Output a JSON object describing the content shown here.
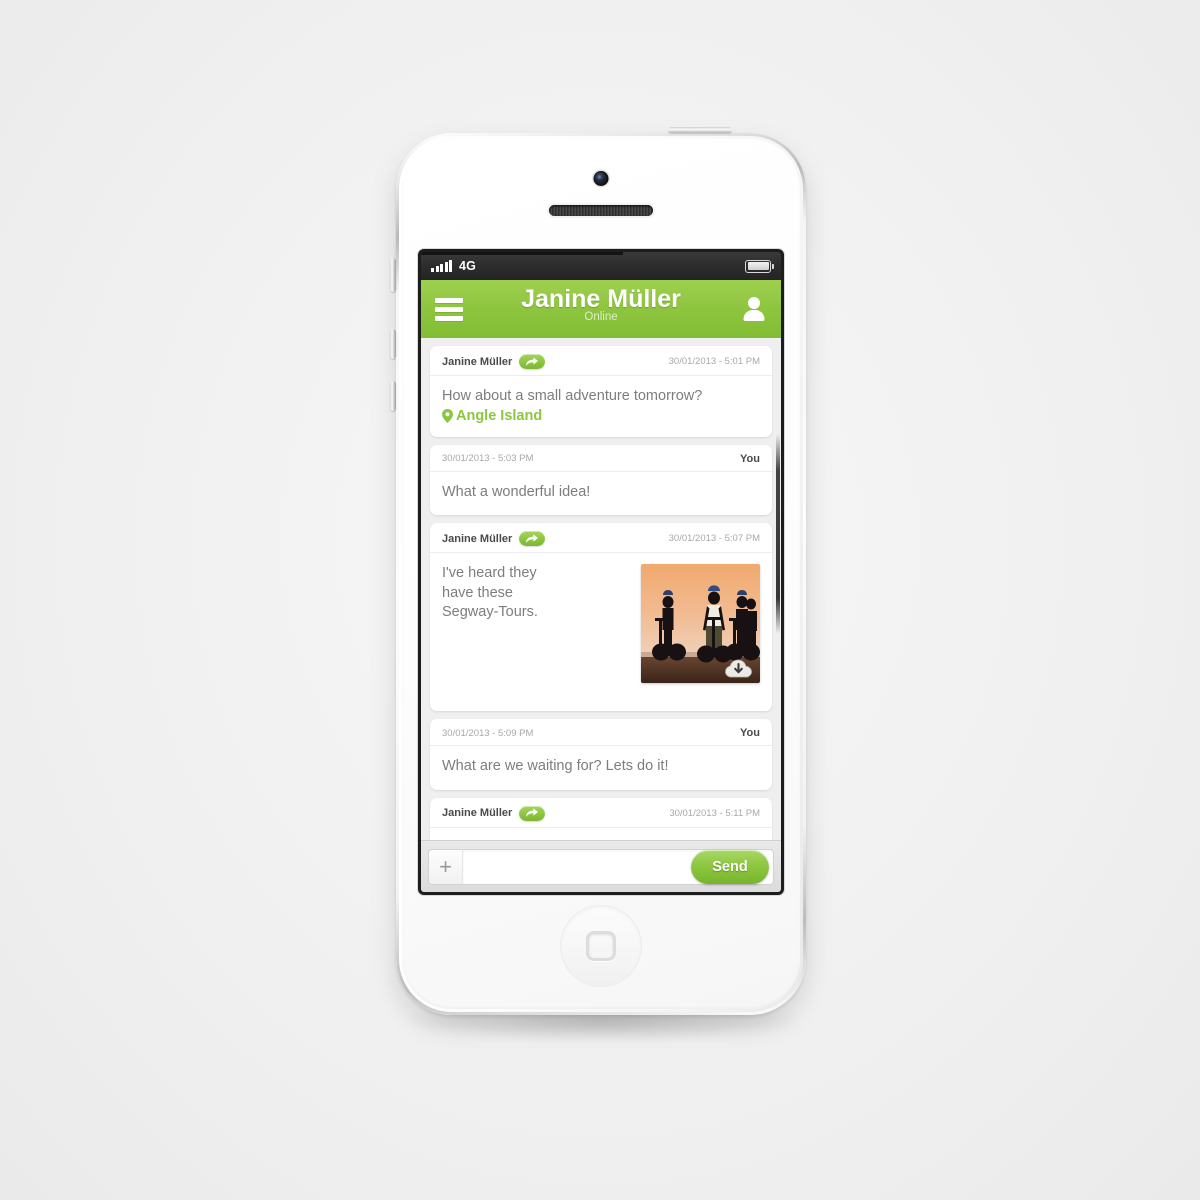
{
  "statusbar": {
    "signal_bars": 5,
    "network": "4G",
    "battery_icon": "battery-full-icon"
  },
  "header": {
    "menu_icon": "hamburger-menu-icon",
    "title": "Janine Müller",
    "status": "Online",
    "contact_icon": "contact-person-icon",
    "accent_color": "#8cc63e"
  },
  "conversation": {
    "messages": [
      {
        "sender": "Janine Müller",
        "incoming": true,
        "timestamp": "30/01/2013 - 5:01 PM",
        "text": "How about a small adventure tomorrow?",
        "location": "Angle Island",
        "reply_icon": "reply-forward-icon"
      },
      {
        "sender": "You",
        "incoming": false,
        "timestamp": "30/01/2013 - 5:03 PM",
        "text": "What a wonderful idea!"
      },
      {
        "sender": "Janine Müller",
        "incoming": true,
        "timestamp": "30/01/2013 - 5:07 PM",
        "text": "I've heard they have these Segway-Tours.",
        "attachment": "segway-tour-photo",
        "download_icon": "cloud-download-icon",
        "reply_icon": "reply-forward-icon"
      },
      {
        "sender": "You",
        "incoming": false,
        "timestamp": "30/01/2013 - 5:09 PM",
        "text": "What are we waiting for? Lets do it!"
      },
      {
        "sender": "Janine Müller",
        "incoming": true,
        "timestamp": "30/01/2013 - 5:11 PM",
        "text": "",
        "reply_icon": "reply-forward-icon"
      }
    ]
  },
  "composer": {
    "attach_label": "+",
    "input_value": "",
    "input_placeholder": "",
    "send_label": "Send"
  },
  "device": {
    "camera_icon": "front-camera",
    "speaker_icon": "earpiece-speaker",
    "home_button_icon": "home-button",
    "power_button": "power-button",
    "volume_up_button": "volume-up-button",
    "volume_down_button": "volume-down-button",
    "silent_switch": "ring-silent-switch"
  }
}
